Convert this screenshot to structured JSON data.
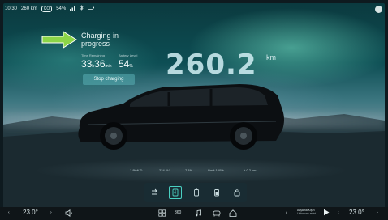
{
  "status_bar": {
    "time": "10:30",
    "range": "260 km",
    "pill": "CO",
    "battery": "54%",
    "icons": [
      "signal-icon",
      "bluetooth-icon",
      "battery-status-icon"
    ]
  },
  "charging": {
    "title": "Charging in progress",
    "time_label": "Time Remaining",
    "battery_label": "Battery Level",
    "hours": "33",
    "minutes_sep": "h",
    "minutes": "36",
    "minutes_unit": "min",
    "battery_value": "54",
    "battery_unit": "%",
    "stop_label": "Stop charging"
  },
  "range": {
    "value": "260.2",
    "unit": "km"
  },
  "stats": [
    "1.8kW D",
    "224.6V",
    "7.8A",
    "Limit 100%",
    "+ 0.2 km"
  ],
  "dock": {
    "items": [
      "charge-port-icon",
      "charging-icon",
      "battery-icon",
      "battery-saver-icon",
      "lock-battery-icon"
    ],
    "active_index": 1
  },
  "bottom_bar": {
    "left_temp": "23.0°",
    "right_temp": "23.0°",
    "media_title": "Akşama Kışın",
    "media_sub": "Unknown artist",
    "center_icons": [
      "apps-icon",
      "360-view-icon",
      "music-icon",
      "seat-icon",
      "car-icon",
      "home-icon"
    ]
  },
  "colors": {
    "accent": "#4ad0c2",
    "arrow": "#8cd548",
    "stop_button": "#5aafb4"
  }
}
